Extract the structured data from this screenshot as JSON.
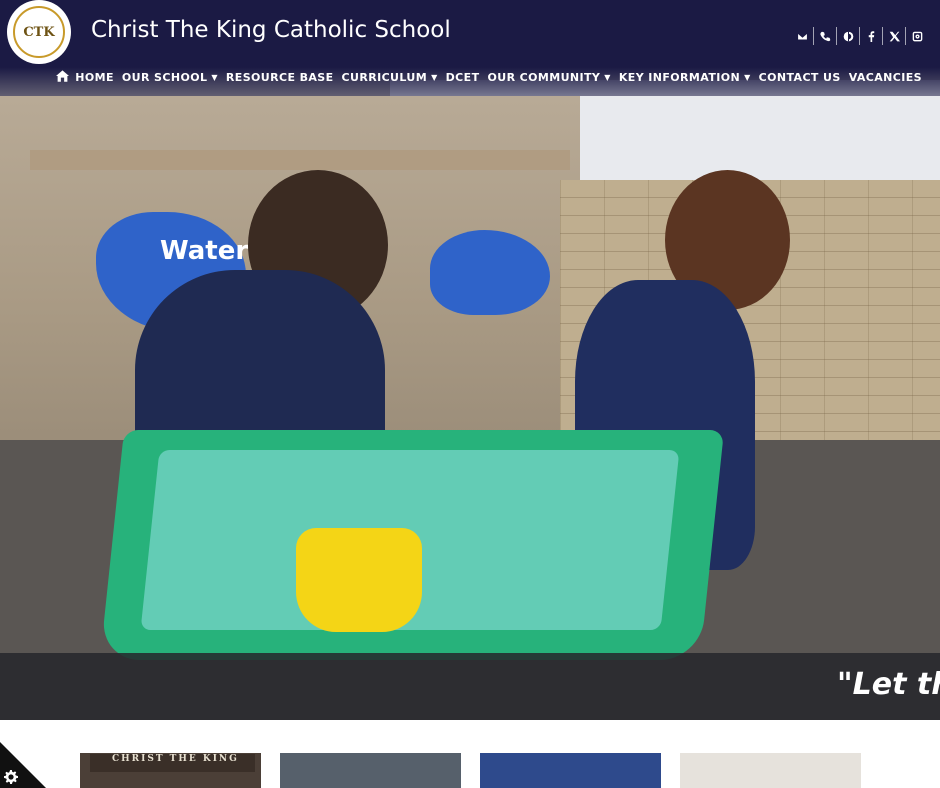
{
  "site": {
    "title": "Christ The King Catholic School",
    "logo_monogram": "CTK",
    "logo_ribbon": "CHRIST THE KING"
  },
  "contact_icons": [
    "email-icon",
    "phone-icon",
    "translate-icon",
    "facebook-icon",
    "x-icon",
    "instagram-icon"
  ],
  "nav": {
    "items": [
      {
        "label": "HOME",
        "dropdown": false
      },
      {
        "label": "OUR SCHOOL",
        "dropdown": true
      },
      {
        "label": "RESOURCE BASE",
        "dropdown": false
      },
      {
        "label": "CURRICULUM",
        "dropdown": true
      },
      {
        "label": "DCET",
        "dropdown": false
      },
      {
        "label": "OUR COMMUNITY",
        "dropdown": true
      },
      {
        "label": "KEY INFORMATION",
        "dropdown": true
      },
      {
        "label": "CONTACT US",
        "dropdown": false
      },
      {
        "label": "VACANCIES",
        "dropdown": false
      }
    ]
  },
  "hero": {
    "quote": "\"Let the",
    "sign_text": "Water W"
  },
  "thumbnails": {
    "sign_text": "CHRIST THE KING"
  },
  "colors": {
    "header_bg": "#1b1a44",
    "caption_bar": "#26262c",
    "white": "#ffffff"
  }
}
